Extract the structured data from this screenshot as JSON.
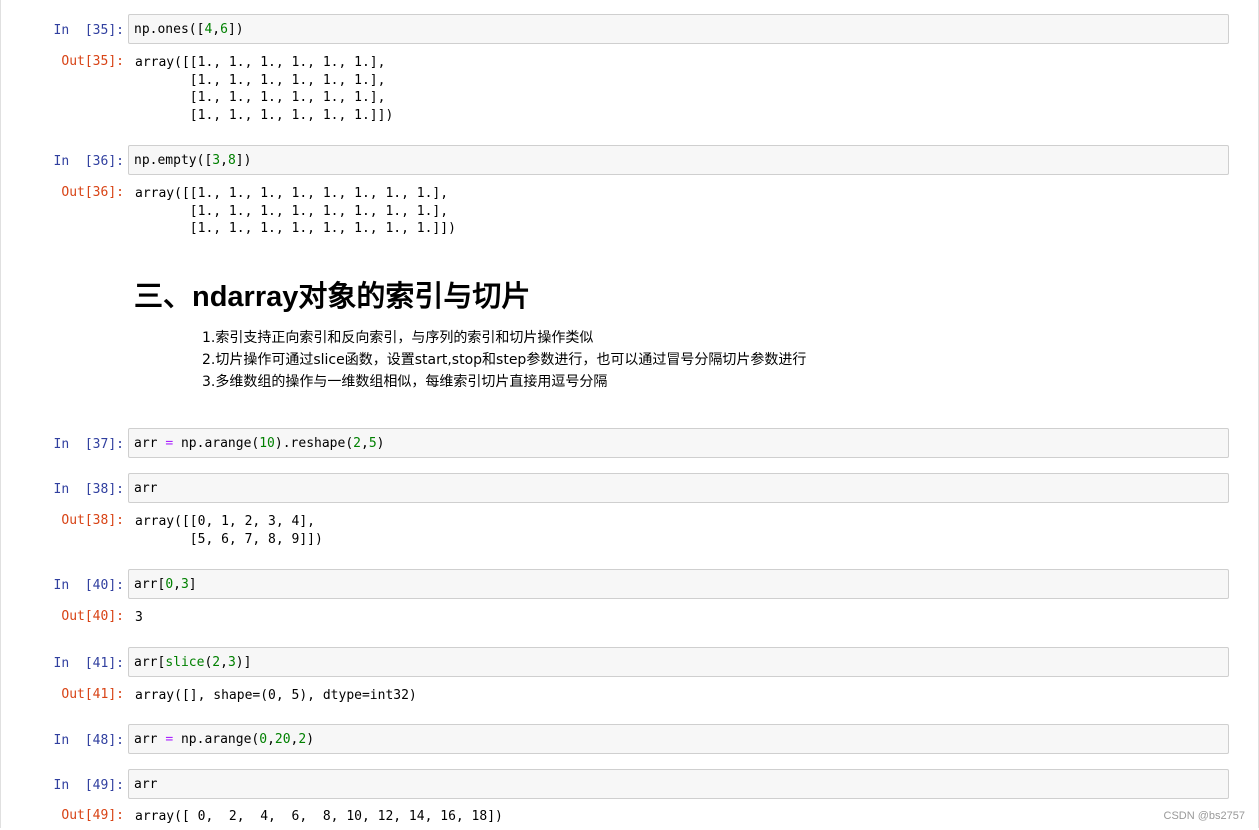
{
  "cells": [
    {
      "in_prompt": "In  [35]:",
      "code_tokens": [
        {
          "t": "np.ones([",
          "c": ""
        },
        {
          "t": "4",
          "c": "num"
        },
        {
          "t": ",",
          "c": ""
        },
        {
          "t": "6",
          "c": "num"
        },
        {
          "t": "])",
          "c": ""
        }
      ],
      "out_prompt": "Out[35]:",
      "output": "array([[1., 1., 1., 1., 1., 1.],\n       [1., 1., 1., 1., 1., 1.],\n       [1., 1., 1., 1., 1., 1.],\n       [1., 1., 1., 1., 1., 1.]])"
    },
    {
      "in_prompt": "In  [36]:",
      "code_tokens": [
        {
          "t": "np.empty([",
          "c": ""
        },
        {
          "t": "3",
          "c": "num"
        },
        {
          "t": ",",
          "c": ""
        },
        {
          "t": "8",
          "c": "num"
        },
        {
          "t": "])",
          "c": ""
        }
      ],
      "out_prompt": "Out[36]:",
      "output": "array([[1., 1., 1., 1., 1., 1., 1., 1.],\n       [1., 1., 1., 1., 1., 1., 1., 1.],\n       [1., 1., 1., 1., 1., 1., 1., 1.]])"
    },
    {
      "in_prompt": "In  [37]:",
      "code_tokens": [
        {
          "t": "arr ",
          "c": ""
        },
        {
          "t": "=",
          "c": "op"
        },
        {
          "t": " np.arange(",
          "c": ""
        },
        {
          "t": "10",
          "c": "num"
        },
        {
          "t": ").reshape(",
          "c": ""
        },
        {
          "t": "2",
          "c": "num"
        },
        {
          "t": ",",
          "c": ""
        },
        {
          "t": "5",
          "c": "num"
        },
        {
          "t": ")",
          "c": ""
        }
      ],
      "out_prompt": "",
      "output": ""
    },
    {
      "in_prompt": "In  [38]:",
      "code_tokens": [
        {
          "t": "arr",
          "c": ""
        }
      ],
      "out_prompt": "Out[38]:",
      "output": "array([[0, 1, 2, 3, 4],\n       [5, 6, 7, 8, 9]])"
    },
    {
      "in_prompt": "In  [40]:",
      "code_tokens": [
        {
          "t": "arr[",
          "c": ""
        },
        {
          "t": "0",
          "c": "num"
        },
        {
          "t": ",",
          "c": ""
        },
        {
          "t": "3",
          "c": "num"
        },
        {
          "t": "]",
          "c": ""
        }
      ],
      "out_prompt": "Out[40]:",
      "output": "3"
    },
    {
      "in_prompt": "In  [41]:",
      "code_tokens": [
        {
          "t": "arr[",
          "c": ""
        },
        {
          "t": "slice",
          "c": "fn"
        },
        {
          "t": "(",
          "c": ""
        },
        {
          "t": "2",
          "c": "num"
        },
        {
          "t": ",",
          "c": ""
        },
        {
          "t": "3",
          "c": "num"
        },
        {
          "t": ")]",
          "c": ""
        }
      ],
      "out_prompt": "Out[41]:",
      "output": "array([], shape=(0, 5), dtype=int32)"
    },
    {
      "in_prompt": "In  [48]:",
      "code_tokens": [
        {
          "t": "arr ",
          "c": ""
        },
        {
          "t": "=",
          "c": "op"
        },
        {
          "t": " np.arange(",
          "c": ""
        },
        {
          "t": "0",
          "c": "num"
        },
        {
          "t": ",",
          "c": ""
        },
        {
          "t": "20",
          "c": "num"
        },
        {
          "t": ",",
          "c": ""
        },
        {
          "t": "2",
          "c": "num"
        },
        {
          "t": ")",
          "c": ""
        }
      ],
      "out_prompt": "",
      "output": ""
    },
    {
      "in_prompt": "In  [49]:",
      "code_tokens": [
        {
          "t": "arr",
          "c": ""
        }
      ],
      "out_prompt": "Out[49]:",
      "output": "array([ 0,  2,  4,  6,  8, 10, 12, 14, 16, 18])"
    }
  ],
  "markdown": {
    "title": "三、ndarray对象的索引与切片",
    "items": [
      "1.索引支持正向索引和反向索引，与序列的索引和切片操作类似",
      "2.切片操作可通过slice函数，设置start,stop和step参数进行，也可以通过冒号分隔切片参数进行",
      "3.多维数组的操作与一维数组相似，每维索引切片直接用逗号分隔"
    ]
  },
  "watermark": "CSDN @bs2757"
}
